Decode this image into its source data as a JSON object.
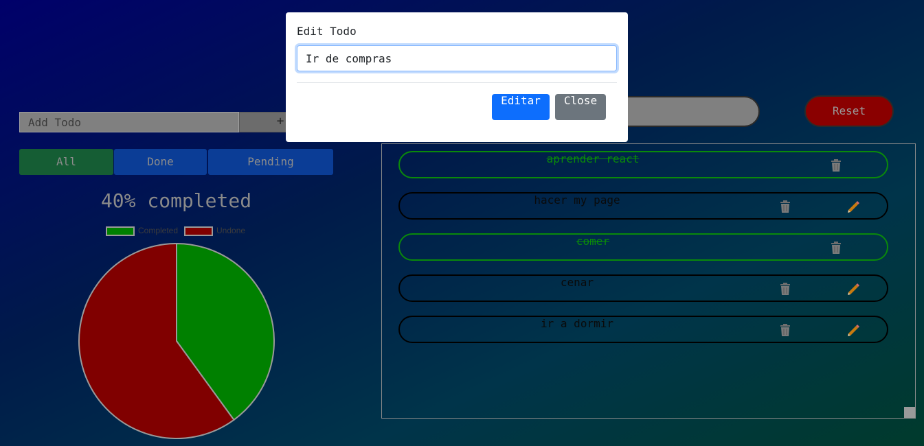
{
  "add_todo": {
    "placeholder": "Add Todo",
    "button_label": "+"
  },
  "filters": [
    {
      "label": "All",
      "color": "#155d34"
    },
    {
      "label": "Done",
      "color": "#0b3d96"
    },
    {
      "label": "Pending",
      "color": "#0b3d96"
    }
  ],
  "progress": {
    "text": "40% completed",
    "percent": 40
  },
  "chart_data": {
    "type": "pie",
    "labels": [
      "Completed",
      "Undone"
    ],
    "values": [
      40,
      60
    ],
    "colors": [
      "#008000",
      "#800000"
    ],
    "legend": "top"
  },
  "reset_label": "Reset",
  "todos": [
    {
      "text": "aprender react",
      "done": true
    },
    {
      "text": "hacer my page",
      "done": false
    },
    {
      "text": "comer",
      "done": true
    },
    {
      "text": "cenar",
      "done": false
    },
    {
      "text": "ir a dormir",
      "done": false
    }
  ],
  "modal": {
    "title": "Edit Todo",
    "input_value": "Ir de compras",
    "edit_label": "Editar",
    "close_label": "Close"
  }
}
